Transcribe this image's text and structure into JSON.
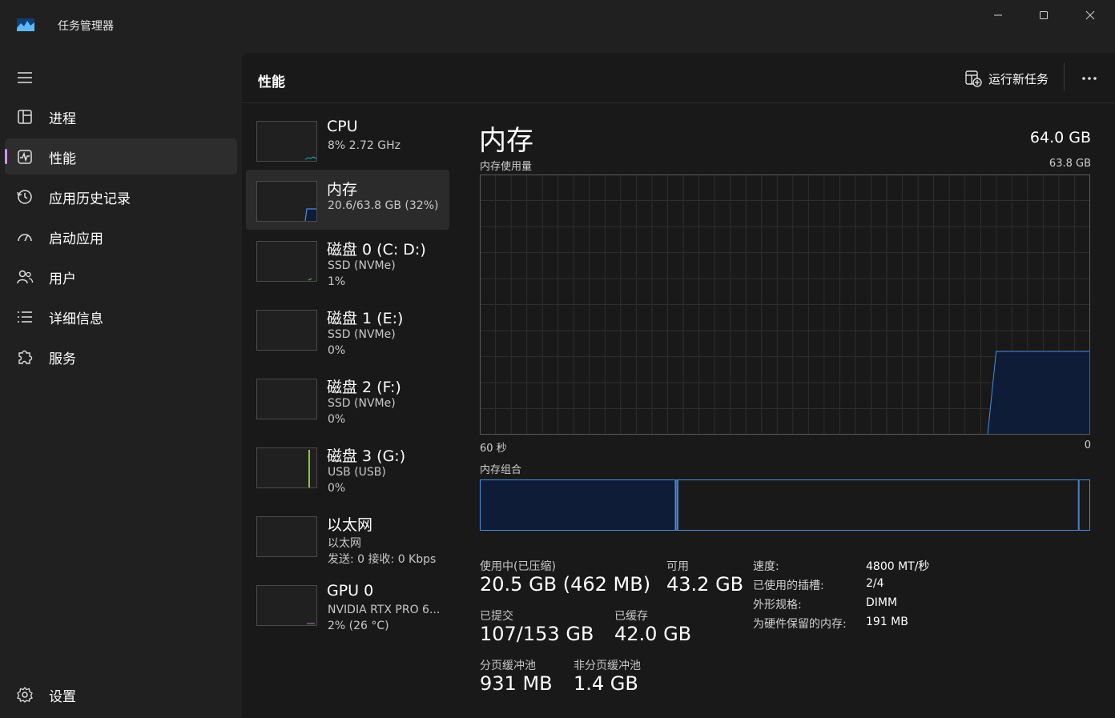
{
  "window": {
    "title": "任务管理器"
  },
  "sidebar": {
    "items": [
      {
        "label": "进程",
        "icon": "processes-icon"
      },
      {
        "label": "性能",
        "icon": "performance-icon",
        "active": true
      },
      {
        "label": "应用历史记录",
        "icon": "history-icon"
      },
      {
        "label": "启动应用",
        "icon": "startup-icon"
      },
      {
        "label": "用户",
        "icon": "users-icon"
      },
      {
        "label": "详细信息",
        "icon": "details-icon"
      },
      {
        "label": "服务",
        "icon": "services-icon"
      }
    ],
    "settings_label": "设置",
    "accent_color": "#d690ff"
  },
  "header": {
    "title": "性能",
    "run_task_label": "运行新任务"
  },
  "devices": [
    {
      "name": "CPU",
      "sub1": "8% 2.72 GHz",
      "sub2": ""
    },
    {
      "name": "内存",
      "sub1": "20.6/63.8 GB (32%)",
      "sub2": "",
      "active": true
    },
    {
      "name": "磁盘 0 (C: D:)",
      "sub1": "SSD (NVMe)",
      "sub2": "1%"
    },
    {
      "name": "磁盘 1 (E:)",
      "sub1": "SSD (NVMe)",
      "sub2": "0%"
    },
    {
      "name": "磁盘 2 (F:)",
      "sub1": "SSD (NVMe)",
      "sub2": "0%"
    },
    {
      "name": "磁盘 3 (G:)",
      "sub1": "USB (USB)",
      "sub2": "0%"
    },
    {
      "name": "以太网",
      "sub1": "以太网",
      "sub2": "发送: 0 接收: 0 Kbps"
    },
    {
      "name": "GPU 0",
      "sub1": "NVIDIA RTX PRO 6...",
      "sub2": "2% (26 °C)"
    }
  ],
  "memory": {
    "title": "内存",
    "total": "64.0 GB",
    "usage_label": "内存使用量",
    "usage_max": "63.8 GB",
    "time_left": "60 秒",
    "time_right": "0",
    "composition_label": "内存组合",
    "accent_color": "#4c8cdb",
    "fill_color": "#0f1c38",
    "usage_fraction": 0.32,
    "composition": {
      "in_use": 20.5,
      "modified": 0.2,
      "standby": 42.0,
      "free": 1.2
    },
    "stats": {
      "in_use_label": "使用中(已压缩)",
      "in_use_value": "20.5 GB (462 MB)",
      "available_label": "可用",
      "available_value": "43.2 GB",
      "committed_label": "已提交",
      "committed_value": "107/153 GB",
      "cached_label": "已缓存",
      "cached_value": "42.0 GB",
      "paged_label": "分页缓冲池",
      "paged_value": "931 MB",
      "nonpaged_label": "非分页缓冲池",
      "nonpaged_value": "1.4 GB"
    },
    "specs": [
      {
        "label": "速度:",
        "value": "4800 MT/秒"
      },
      {
        "label": "已使用的插槽:",
        "value": "2/4"
      },
      {
        "label": "外形规格:",
        "value": "DIMM"
      },
      {
        "label": "为硬件保留的内存:",
        "value": "191 MB"
      }
    ]
  }
}
